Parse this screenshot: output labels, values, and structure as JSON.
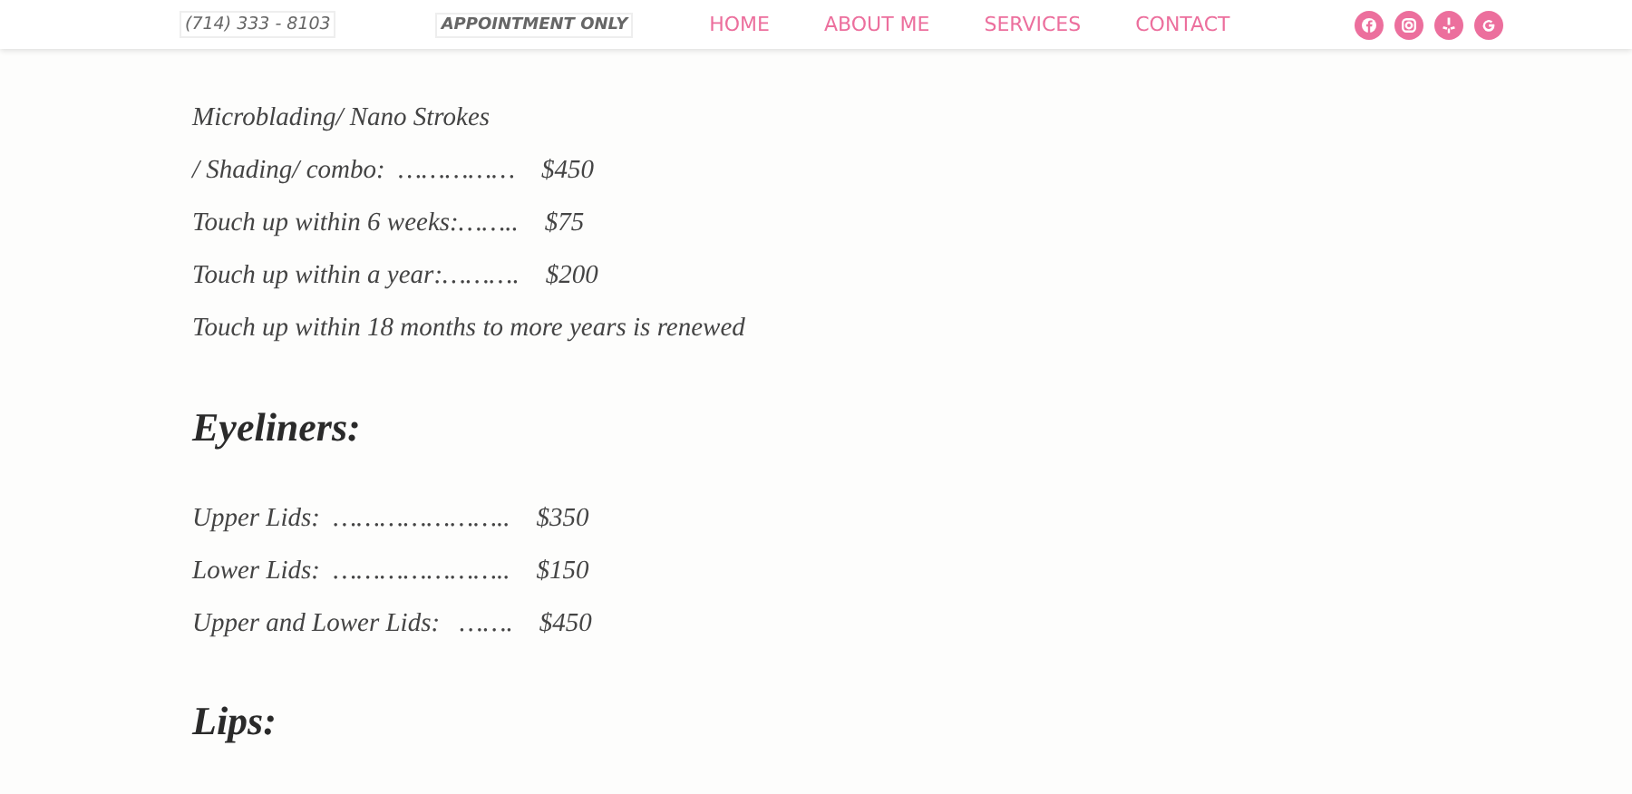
{
  "header": {
    "phone": "(714) 333 - 8103",
    "note": "APPOINTMENT ONLY",
    "nav": [
      {
        "label": "HOME"
      },
      {
        "label": "ABOUT ME"
      },
      {
        "label": "SERVICES"
      },
      {
        "label": "CONTACT"
      }
    ]
  },
  "sections": [
    {
      "lines": [
        "Microblading/ Nano Strokes",
        "/ Shading/ combo:  ……………    $450",
        "Touch up within 6 weeks:……..    $75",
        "Touch up within a year:……….    $200",
        "Touch up within 18 months to more years is renewed"
      ]
    },
    {
      "heading": "Eyeliners:",
      "lines": [
        "Upper Lids:  …………………..    $350",
        "Lower Lids:  …………………..    $150",
        "Upper and Lower Lids:   …….    $450"
      ]
    },
    {
      "heading": "Lips:"
    }
  ]
}
